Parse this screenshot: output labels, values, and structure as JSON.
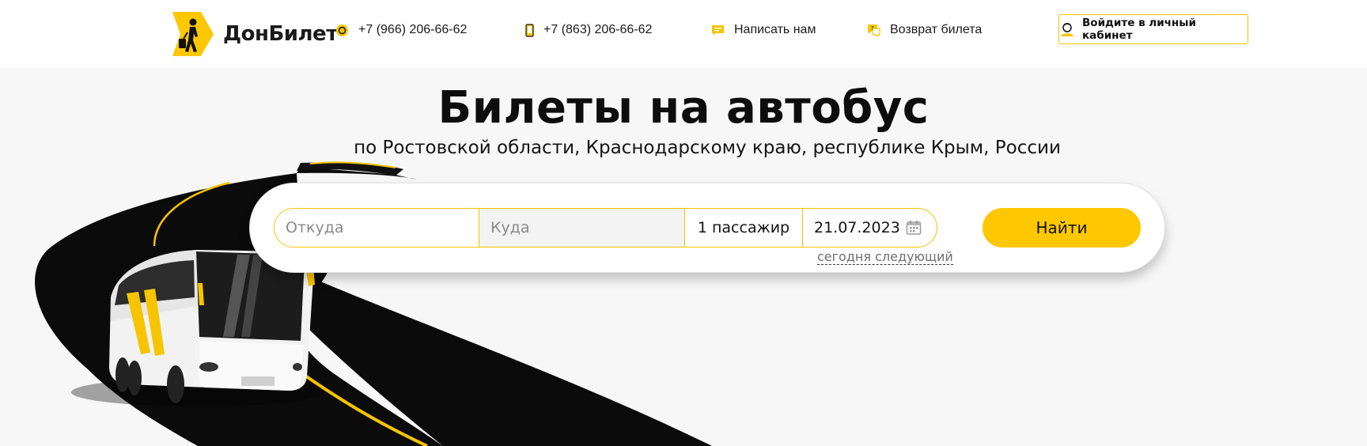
{
  "header": {
    "logo_text": "ДонБилет",
    "contacts": [
      {
        "label": "+7 (966) 206-66-62",
        "icon": "viber-icon"
      },
      {
        "label": "+7 (863) 206-66-62",
        "icon": "phone-icon"
      },
      {
        "label": "Написать нам",
        "icon": "chat-icon"
      },
      {
        "label": "Возврат билета",
        "icon": "return-ticket-icon"
      }
    ],
    "login_label": "Войдите в личный кабинет"
  },
  "hero": {
    "title": "Билеты на автобус",
    "subtitle": "по Ростовской области, Краснодарскому краю, республике Крым, России"
  },
  "search": {
    "from_placeholder": "Откуда",
    "to_placeholder": "Куда",
    "passengers": "1 пассажир",
    "date": "21.07.2023",
    "quick_dates": "сегодня следующий",
    "submit_label": "Найти"
  },
  "colors": {
    "accent": "#fdc800",
    "road": "#0a0a0a",
    "background": "#f7f7f7"
  }
}
